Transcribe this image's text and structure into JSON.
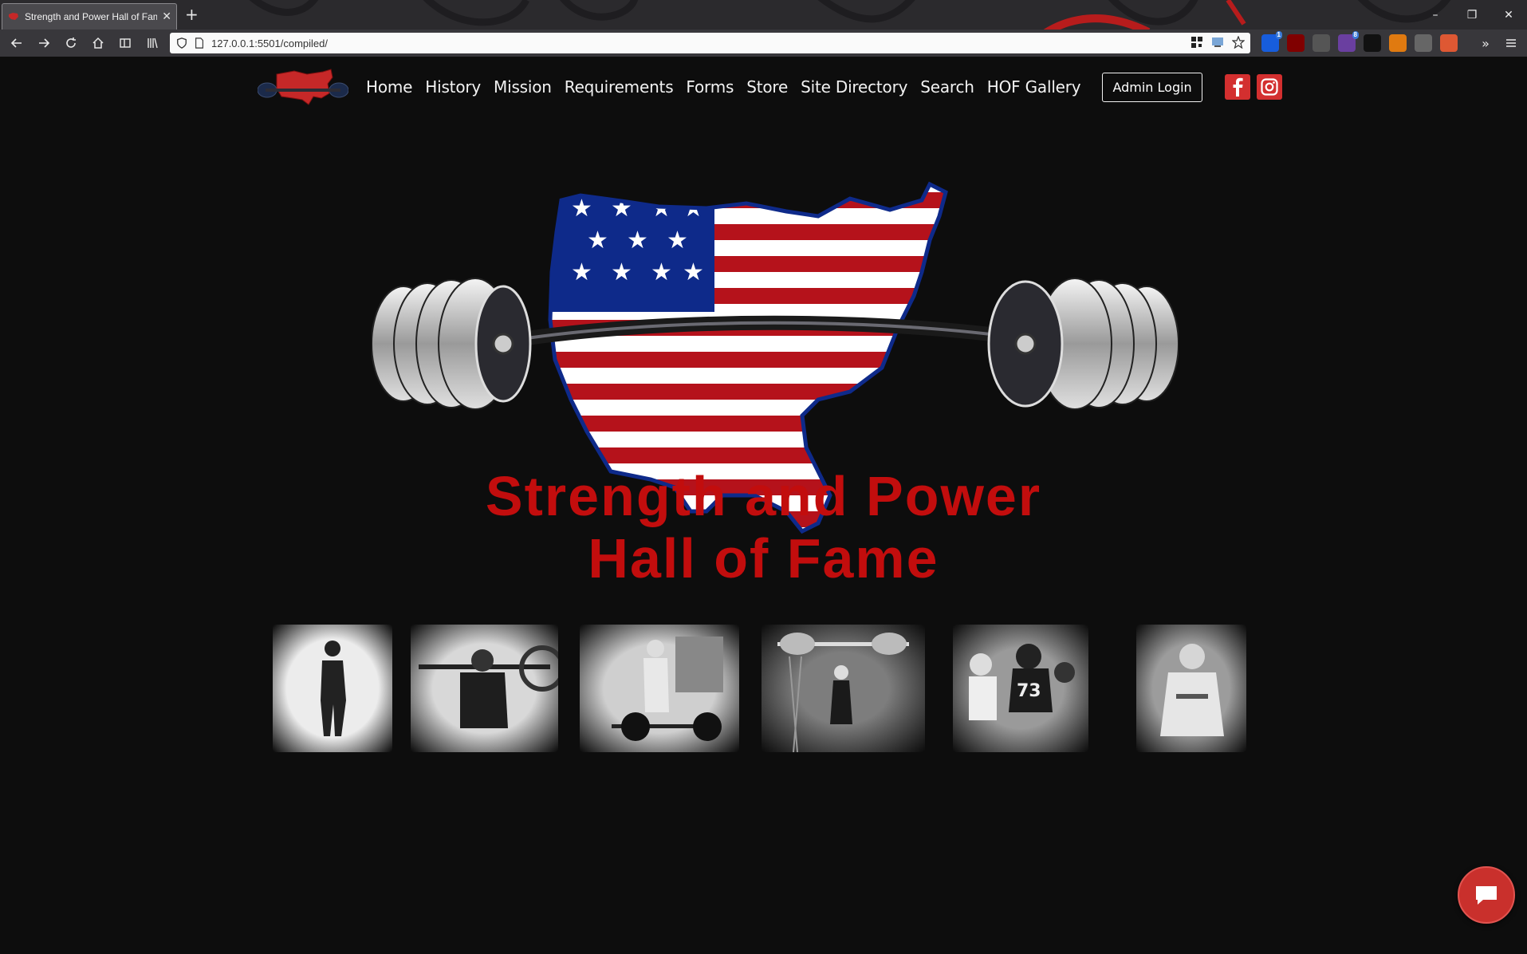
{
  "browser": {
    "tab_title": "Strength and Power Hall of Fam",
    "url": "127.0.0.1:5501/compiled/",
    "extensions": [
      {
        "icon": "bitwarden-icon",
        "badge": "1",
        "color": "#175ddc"
      },
      {
        "icon": "ublock-icon",
        "badge": "",
        "color": "#800000"
      },
      {
        "icon": "screenshot-icon",
        "badge": "",
        "color": "#555555"
      },
      {
        "icon": "tab-manager-icon",
        "badge": "8",
        "color": "#6a3fa0"
      },
      {
        "icon": "tampermonkey-icon",
        "badge": "",
        "color": "#111111"
      },
      {
        "icon": "fox-icon",
        "badge": "",
        "color": "#e07a10"
      },
      {
        "icon": "reader-icon",
        "badge": "",
        "color": "#666666"
      },
      {
        "icon": "duckduckgo-icon",
        "badge": "",
        "color": "#de5833"
      }
    ]
  },
  "site": {
    "menu": [
      "Home",
      "History",
      "Mission",
      "Requirements",
      "Forms",
      "Store",
      "Site Directory",
      "Search",
      "HOF Gallery"
    ],
    "admin_label": "Admin Login",
    "social": [
      "facebook-icon",
      "instagram-icon"
    ],
    "hero_title_line1": "Strength and Power",
    "hero_title_line2": "Hall of Fame",
    "gallery": [
      {
        "name": "gallery-photo-woman-pose"
      },
      {
        "name": "gallery-photo-lifter-bar"
      },
      {
        "name": "gallery-photo-deadlift"
      },
      {
        "name": "gallery-photo-olympic-lift"
      },
      {
        "name": "gallery-photo-football"
      },
      {
        "name": "gallery-photo-man"
      }
    ]
  },
  "colors": {
    "accent_red": "#c20d0d",
    "background": "#0d0d0d",
    "flag_blue": "#0e2a8a"
  }
}
